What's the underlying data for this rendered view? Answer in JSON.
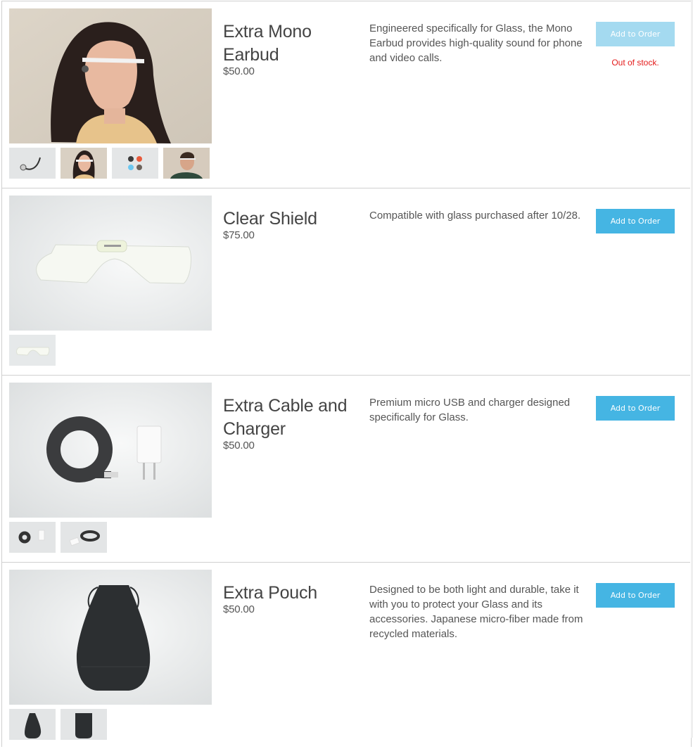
{
  "products": [
    {
      "name": "Extra Mono Earbud",
      "price": "$50.00",
      "description": "Engineered specifically for Glass, the Mono Earbud provides high-quality sound for phone and video calls.",
      "button_label": "Add to Order",
      "button_disabled": true,
      "stock_status": "Out of stock.",
      "thumbnails": [
        "earbud-cable",
        "woman-wearing-glass",
        "earbud-colors",
        "man-wearing-glass"
      ]
    },
    {
      "name": "Clear Shield",
      "price": "$75.00",
      "description": "Compatible with glass purchased after 10/28.",
      "button_label": "Add to Order",
      "button_disabled": false,
      "thumbnails": [
        "clear-shield"
      ]
    },
    {
      "name": "Extra Cable and Charger",
      "price": "$50.00",
      "description": "Premium micro USB and charger designed specifically for Glass.",
      "button_label": "Add to Order",
      "button_disabled": false,
      "thumbnails": [
        "cable-and-charger",
        "charger-angled"
      ]
    },
    {
      "name": "Extra Pouch",
      "price": "$50.00",
      "description": "Designed to be both light and durable, take it with you to protect your Glass and its accessories. Japanese micro-fiber made from recycled materials.",
      "button_label": "Add to Order",
      "button_disabled": false,
      "thumbnails": [
        "pouch-front",
        "pouch-flat"
      ]
    }
  ],
  "colors": {
    "button": "#45b5e3",
    "button_disabled": "#a4daf0",
    "out_of_stock": "#e41b1b"
  }
}
